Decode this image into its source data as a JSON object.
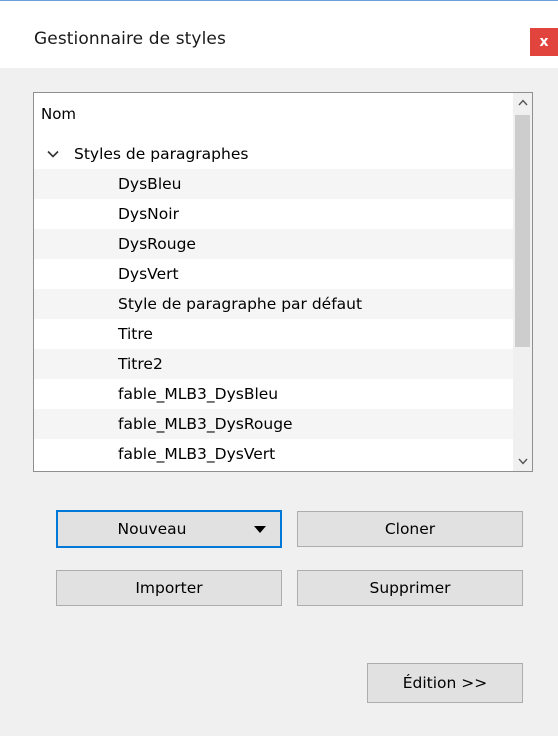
{
  "dialog": {
    "title": "Gestionnaire de styles",
    "close_label": "x"
  },
  "tree": {
    "header": "Nom",
    "groups": [
      {
        "label": "Styles de paragraphes",
        "expanded": true,
        "items": [
          "DysBleu",
          "DysNoir",
          "DysRouge",
          "DysVert",
          "Style de paragraphe par défaut",
          "Titre",
          "Titre2",
          "fable_MLB3_DysBleu",
          "fable_MLB3_DysRouge",
          "fable_MLB3_DysVert"
        ]
      }
    ]
  },
  "buttons": {
    "new_label": "Nouveau",
    "clone_label": "Cloner",
    "import_label": "Importer",
    "delete_label": "Supprimer",
    "edit_label": "Édition >>"
  },
  "colors": {
    "close_red": "#e0443c",
    "focus_blue": "#0078d7",
    "dialog_bg": "#f0f0f0"
  }
}
